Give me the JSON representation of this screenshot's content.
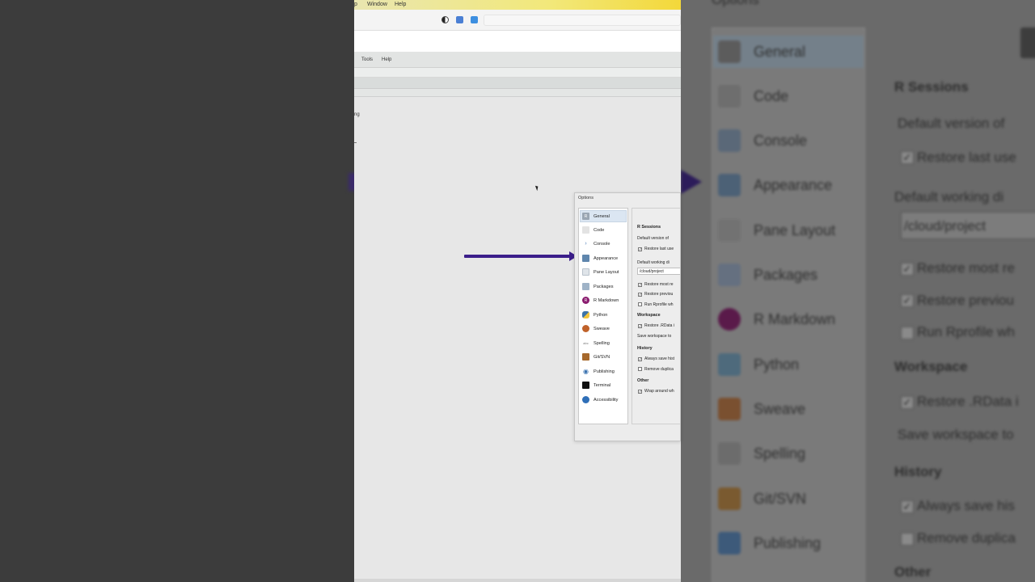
{
  "mac_menu": {
    "items": [
      "p",
      "Window",
      "Help"
    ]
  },
  "rstudio_menu": {
    "items": [
      "Tools",
      "Help"
    ]
  },
  "workspace": {
    "fragment": "ng"
  },
  "dialog": {
    "title": "Options",
    "nav": [
      {
        "label": "General",
        "icon": "general-icon",
        "color": "#9aa6b3"
      },
      {
        "label": "Code",
        "icon": "code-icon",
        "color": "#d9d9d9"
      },
      {
        "label": "Console",
        "icon": "console-icon",
        "color": "#7ea0c8"
      },
      {
        "label": "Appearance",
        "icon": "appearance-icon",
        "color": "#5f86ad"
      },
      {
        "label": "Pane Layout",
        "icon": "pane-layout-icon",
        "color": "#cfd6dd"
      },
      {
        "label": "Packages",
        "icon": "packages-icon",
        "color": "#9fb3c7"
      },
      {
        "label": "R Markdown",
        "icon": "r-markdown-icon",
        "color": "#8a1c6f"
      },
      {
        "label": "Python",
        "icon": "python-icon",
        "color": "#3d74a8"
      },
      {
        "label": "Sweave",
        "icon": "sweave-icon",
        "color": "#c0622a"
      },
      {
        "label": "Spelling",
        "icon": "spelling-icon",
        "color": "#bdbdbd"
      },
      {
        "label": "Git/SVN",
        "icon": "git-svn-icon",
        "color": "#a6692c"
      },
      {
        "label": "Publishing",
        "icon": "publishing-icon",
        "color": "#3a72b0"
      },
      {
        "label": "Terminal",
        "icon": "terminal-icon",
        "color": "#111111"
      },
      {
        "label": "Accessibility",
        "icon": "accessibility-icon",
        "color": "#2f6fb8"
      }
    ],
    "content": {
      "r_sessions_heading": "R Sessions",
      "default_version": "Default version of",
      "restore_last": "Restore last use",
      "default_wd": "Default working di",
      "wd_value": "/cloud/project",
      "restore_most": "Restore most re",
      "restore_previous": "Restore previou",
      "run_rprofile": "Run Rprofile wh",
      "workspace_heading": "Workspace",
      "restore_rdata": "Restore .RData i",
      "save_workspace": "Save workspace to",
      "history_heading": "History",
      "always_save": "Always save hist",
      "remove_dup": "Remove duplica",
      "other_heading": "Other",
      "wrap_around": "Wrap around wh"
    }
  },
  "zoom": {
    "nav": [
      "General",
      "Code",
      "Console",
      "Appearance",
      "Pane Layout",
      "Packages",
      "R Markdown",
      "Python",
      "Sweave",
      "Spelling",
      "Git/SVN",
      "Publishing"
    ],
    "content": {
      "r_sessions_heading": "R Sessions",
      "default_version": "Default version of",
      "restore_last": "Restore last use",
      "default_wd": "Default working di",
      "wd_value": "/cloud/project",
      "restore_most": "Restore most re",
      "restore_previous": "Restore previou",
      "run_rprofile": "Run Rprofile wh",
      "workspace_heading": "Workspace",
      "restore_rdata": "Restore .RData i",
      "save_workspace": "Save workspace to",
      "history_heading": "History",
      "always_save": "Always save his",
      "remove_dup": "Remove duplica",
      "other_heading": "Other"
    },
    "top_fragment": "Options"
  }
}
